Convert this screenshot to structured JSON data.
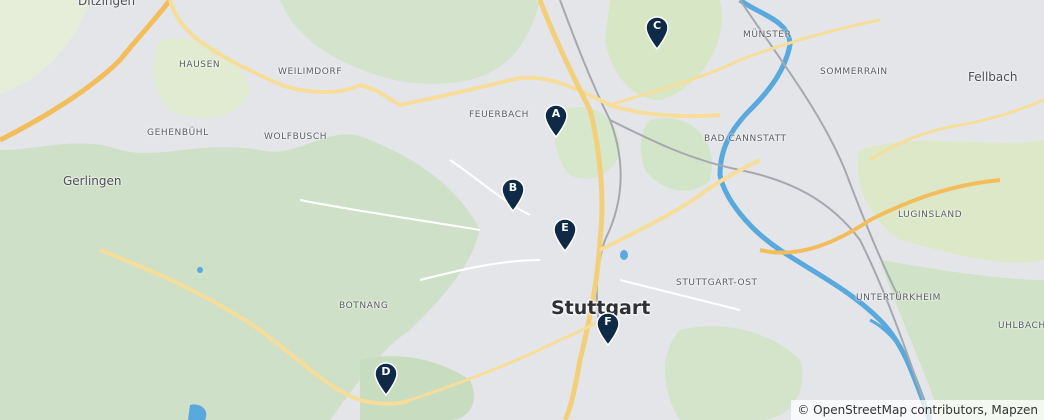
{
  "map": {
    "places": [
      {
        "id": "ditzingen",
        "label": "Ditzingen",
        "kind": "town"
      },
      {
        "id": "hausen",
        "label": "HAUSEN",
        "kind": "district"
      },
      {
        "id": "weilimdorf",
        "label": "WEILIMDORF",
        "kind": "district"
      },
      {
        "id": "feuerbach",
        "label": "FEUERBACH",
        "kind": "district"
      },
      {
        "id": "gehenbuehl",
        "label": "GEHENBÜHL",
        "kind": "district"
      },
      {
        "id": "wolfbusch",
        "label": "WOLFBUSCH",
        "kind": "district"
      },
      {
        "id": "gerlingen",
        "label": "Gerlingen",
        "kind": "town"
      },
      {
        "id": "muenster",
        "label": "MÜNSTER",
        "kind": "district"
      },
      {
        "id": "sommerrain",
        "label": "SOMMERRAIN",
        "kind": "district"
      },
      {
        "id": "fellbach",
        "label": "Fellbach",
        "kind": "town"
      },
      {
        "id": "bad-cannstatt",
        "label": "BAD CANNSTATT",
        "kind": "district"
      },
      {
        "id": "luginsland",
        "label": "LUGINSLAND",
        "kind": "district"
      },
      {
        "id": "stuttgart-ost",
        "label": "STUTTGART-OST",
        "kind": "district"
      },
      {
        "id": "untertuerkheim",
        "label": "UNTERTÜRKHEIM",
        "kind": "district"
      },
      {
        "id": "uhlbach",
        "label": "UHLBACH",
        "kind": "district"
      },
      {
        "id": "botnang",
        "label": "BOTNANG",
        "kind": "district"
      },
      {
        "id": "stuttgart",
        "label": "Stuttgart",
        "kind": "city"
      }
    ],
    "markers": [
      {
        "id": "A",
        "label": "A",
        "color": "#0e2a47"
      },
      {
        "id": "B",
        "label": "B",
        "color": "#0e2a47"
      },
      {
        "id": "C",
        "label": "C",
        "color": "#0e2a47"
      },
      {
        "id": "D",
        "label": "D",
        "color": "#0e2a47"
      },
      {
        "id": "E",
        "label": "E",
        "color": "#0e2a47"
      },
      {
        "id": "F",
        "label": "F",
        "color": "#0e2a47"
      }
    ],
    "attribution": "© OpenStreetMap contributors, Mapzen",
    "colors": {
      "urban": "#e4e5e9",
      "forest": "#cfe0c8",
      "park": "#dde9d3",
      "water": "#5aa9dc",
      "motorway": "#f2bd5a",
      "road": "#f7dd9a",
      "rail": "#a5a8ad"
    }
  }
}
